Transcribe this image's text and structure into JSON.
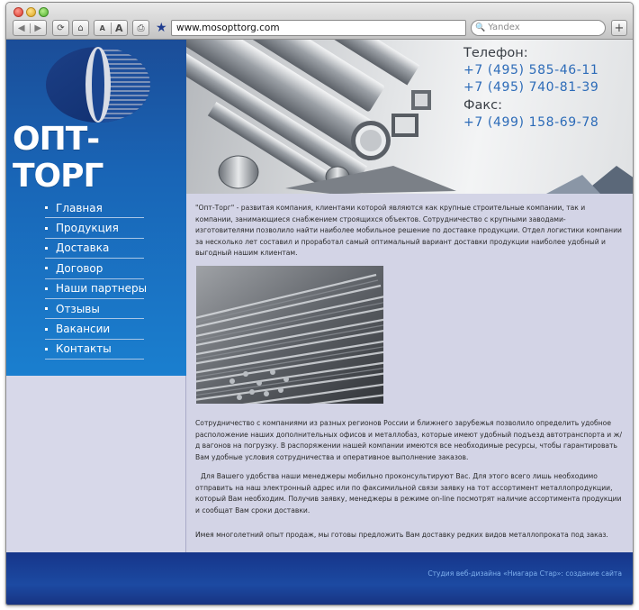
{
  "browser": {
    "address": "www.mosopttorg.com",
    "search_placeholder": "Yandex",
    "font_small_label": "A",
    "font_large_label": "A",
    "new_tab_label": "+",
    "back_glyph": "◀",
    "forward_glyph": "▶",
    "reload_glyph": "⟳",
    "home_glyph": "⌂",
    "print_glyph": "⎙",
    "bookmark_glyph": "★",
    "search_glyph": "🔍"
  },
  "logo": {
    "text": "ОПТ-ТОРГ"
  },
  "nav": {
    "items": [
      {
        "label": "Главная"
      },
      {
        "label": "Продукция"
      },
      {
        "label": "Доставка"
      },
      {
        "label": "Договор"
      },
      {
        "label": "Наши партнеры"
      },
      {
        "label": "Отзывы"
      },
      {
        "label": "Вакансии"
      },
      {
        "label": "Контакты"
      }
    ]
  },
  "header": {
    "phone_label": "Телефон:",
    "phone1": "+7 (495) 585-46-11",
    "phone2": "+7 (495) 740-81-39",
    "fax_label": "Факс:",
    "fax": "+7 (499) 158-69-78"
  },
  "content": {
    "p1": "\"Опт-Торг\" - развитая компания, клиентами которой являются как крупные строительные компании, так и компании, занимающиеся снабжением строящихся объектов. Сотрудничество с крупными заводами-изготовителями позволило найти наиболее мобильное решение по доставке продукции. Отдел логистики компании за несколько лет составил и проработал самый оптимальный вариант доставки продукции наиболее удобный и выгодный нашим клиентам.",
    "p2": "Сотрудничество с компаниями из разных регионов России и ближнего зарубежья позволило определить удобное расположение наших дополнительных офисов и металлобаз, которые имеют удобный подъезд автотранспорта и ж/д вагонов на погрузку. В распоряжении нашей компании имеются все необходимые ресурсы, чтобы гарантировать Вам удобные условия сотрудничества и оперативное выполнение заказов.",
    "p3": "Для Вашего удобства наши менеджеры мобильно проконсультируют Вас. Для этого всего лишь необходимо отправить на наш электронный адрес или по факсимильной связи заявку на тот ассортимент металлопродукции, который Вам необходим. Получив заявку, менеджеры в режиме on-line посмотрят наличие ассортимента продукции и сообщат Вам сроки доставки.",
    "p4": "Имея многолетний опыт продаж, мы готовы предложить Вам доставку редких видов металлопроката под заказ."
  },
  "footer": {
    "credit": "Студия веб-дизайна «Ниагара Стар»: создание сайта"
  },
  "colors": {
    "sidebar": "#1965b6",
    "footer": "#1c4aa2",
    "page_bg": "#d3d4e6",
    "phone": "#2c6bb8",
    "credit": "#7fb1ee"
  }
}
